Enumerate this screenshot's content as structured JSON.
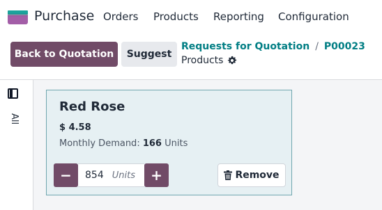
{
  "navbar": {
    "app_name": "Purchase",
    "menu": [
      "Orders",
      "Products",
      "Reporting",
      "Configuration"
    ]
  },
  "control_panel": {
    "back_button": "Back to Quotation",
    "suggest_button": "Suggest",
    "breadcrumb": [
      "Requests for Quotation",
      "P00023"
    ],
    "breadcrumb_separator": "/",
    "current_view": "Products",
    "settings_icon": "gear-icon"
  },
  "sidebar": {
    "toggle_icon": "panel-toggle-icon",
    "filter_label": "All"
  },
  "product_card": {
    "name": "Red Rose",
    "price": "$ 4.58",
    "demand_label": "Monthly Demand:",
    "demand_value": "166",
    "demand_unit": "Units",
    "quantity": "854",
    "quantity_unit": "Units",
    "minus_label": "−",
    "plus_label": "+",
    "remove_label": "Remove",
    "remove_icon": "trash-icon"
  },
  "colors": {
    "primary": "#714b67",
    "link": "#017e84",
    "card_bg": "#e6f0f3",
    "card_border": "#6fa6ae"
  }
}
